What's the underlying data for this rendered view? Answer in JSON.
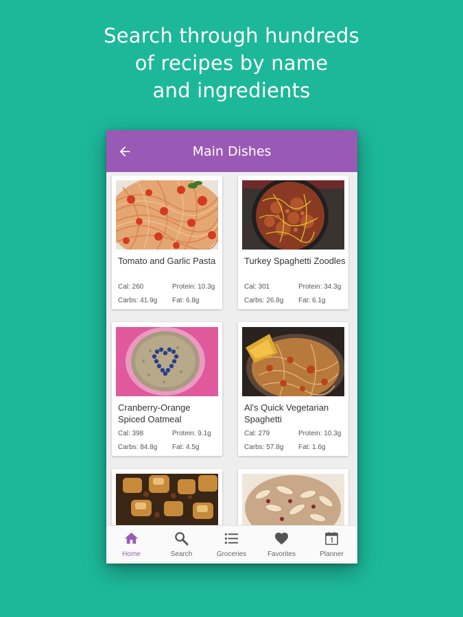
{
  "promo": {
    "line1": "Search through hundreds",
    "line2": "of recipes by name",
    "line3": "and ingredients"
  },
  "appbar": {
    "title": "Main Dishes"
  },
  "recipes": [
    {
      "title": "Tomato and Garlic Pasta",
      "cal": "Cal: 260",
      "protein": "Protein: 10.3g",
      "carbs": "Carbs: 41.9g",
      "fat": "Fat: 6.8g"
    },
    {
      "title": "Turkey Spaghetti Zoodles",
      "cal": "Cal: 301",
      "protein": "Protein: 34.3g",
      "carbs": "Carbs: 26.8g",
      "fat": "Fat: 6.1g"
    },
    {
      "title": "Cranberry-Orange Spiced Oatmeal",
      "cal": "Cal: 398",
      "protein": "Protein: 9.1g",
      "carbs": "Carbs: 84.8g",
      "fat": "Fat: 4.5g"
    },
    {
      "title": "Al's Quick Vegetarian Spaghetti",
      "cal": "Cal: 279",
      "protein": "Protein: 10.3g",
      "carbs": "Carbs: 57.8g",
      "fat": "Fat: 1.6g"
    }
  ],
  "nav": [
    {
      "label": "Home",
      "icon": "home-icon"
    },
    {
      "label": "Search",
      "icon": "search-icon"
    },
    {
      "label": "Groceries",
      "icon": "list-icon"
    },
    {
      "label": "Favorites",
      "icon": "heart-icon"
    },
    {
      "label": "Planner",
      "icon": "calendar-icon"
    }
  ],
  "colors": {
    "background": "#1db89a",
    "appbar": "#9b59b6",
    "active_nav": "#9b59b6"
  }
}
